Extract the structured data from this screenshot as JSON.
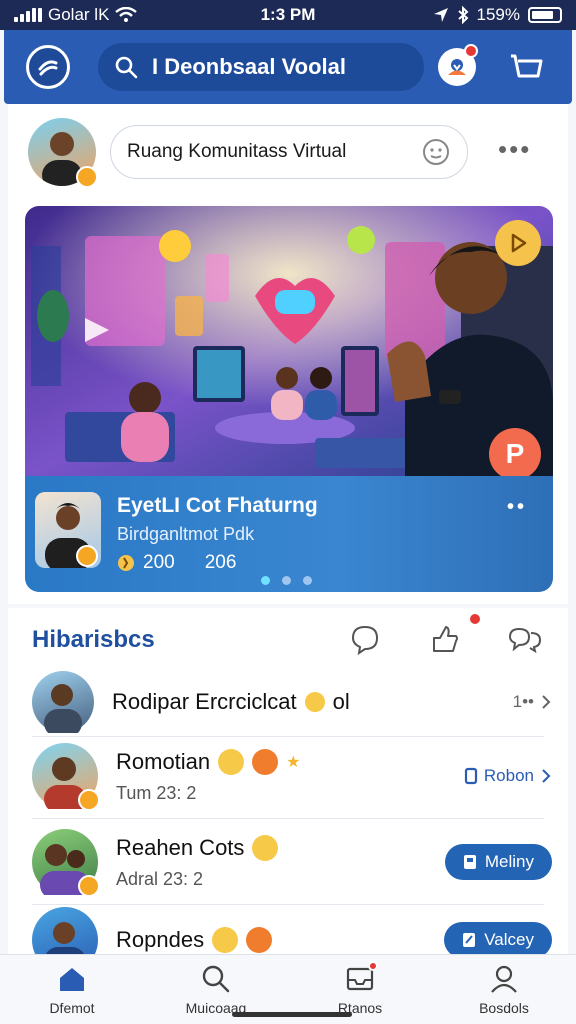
{
  "status_bar": {
    "carrier": "Golar lK",
    "time": "1:3 PM",
    "battery": "159%",
    "battery_level": 0.8
  },
  "header": {
    "search_text": "I Deonbsaal Voolal",
    "icons": [
      "logo-icon",
      "search-icon",
      "notification-icon",
      "cart-icon"
    ]
  },
  "composer": {
    "placeholder": "Ruang Komunitass Virtual",
    "more": "•••"
  },
  "featured": {
    "title": "EyetLI Cot Fhaturng",
    "subtitle": "Birdganltmot Pdk",
    "stat_a": "200",
    "stat_b": "206",
    "more": "••",
    "badge_letter": "P",
    "dots": 3,
    "active_dot": 0
  },
  "list": {
    "heading": "Hibarisbcs",
    "rows": [
      {
        "name": "Rodipar Ercrciclcat",
        "name_suffix": "ol",
        "meta": "",
        "end_text": "1••",
        "end_style": "chevron"
      },
      {
        "name": "Romotian",
        "name_suffix": "",
        "meta": "Tum  23:  2",
        "end_text": "Robon",
        "end_style": "link"
      },
      {
        "name": "Reahen Cots",
        "name_suffix": "",
        "meta": "Adral  23:  2",
        "end_text": "Meliny",
        "end_style": "pill"
      },
      {
        "name": "Ropndes",
        "name_suffix": "",
        "meta": "",
        "end_text": "Valcey",
        "end_style": "pill"
      }
    ]
  },
  "bottom_nav": [
    {
      "label": "Dfemot",
      "icon": "home-icon"
    },
    {
      "label": "Muicoaag",
      "icon": "search-icon"
    },
    {
      "label": "Rtanos",
      "icon": "inbox-icon"
    },
    {
      "label": "Bosdols",
      "icon": "profile-icon"
    }
  ],
  "colors": {
    "brand": "#2a5cb3",
    "accent": "#3a86d0",
    "badge": "#e53935"
  }
}
